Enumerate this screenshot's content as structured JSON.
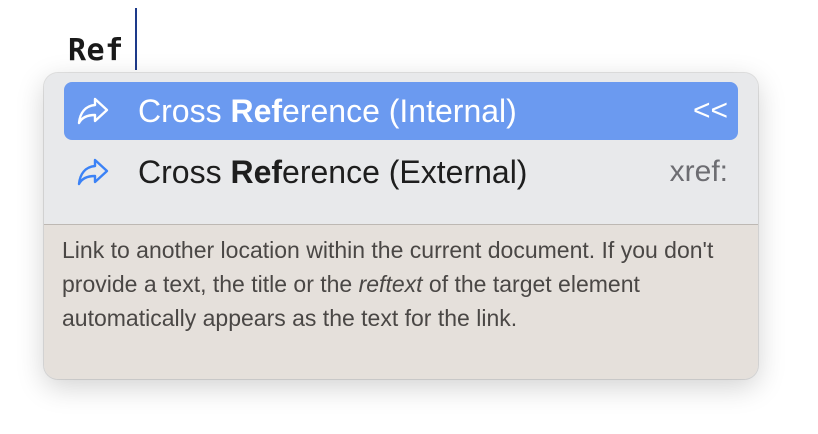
{
  "editor": {
    "typed_text": "Ref"
  },
  "completion": {
    "items": [
      {
        "label_pre": "Cross ",
        "label_match": "Ref",
        "label_post": "erence (Internal)",
        "shortcut": "<<",
        "icon": "arrow-share-icon",
        "selected": true
      },
      {
        "label_pre": "Cross ",
        "label_match": "Ref",
        "label_post": "erence (External)",
        "shortcut": "xref:",
        "icon": "arrow-share-icon",
        "selected": false
      }
    ],
    "description": {
      "part1": "Link to another location within the current document. If you don't provide a text, the title or the ",
      "emphasis": "reftext",
      "part2": " of the target element automatically appears as the text for the link."
    }
  },
  "colors": {
    "selection": "#6b9af0",
    "icon_blue": "#3b82f6",
    "caret": "#1d3a8a"
  }
}
